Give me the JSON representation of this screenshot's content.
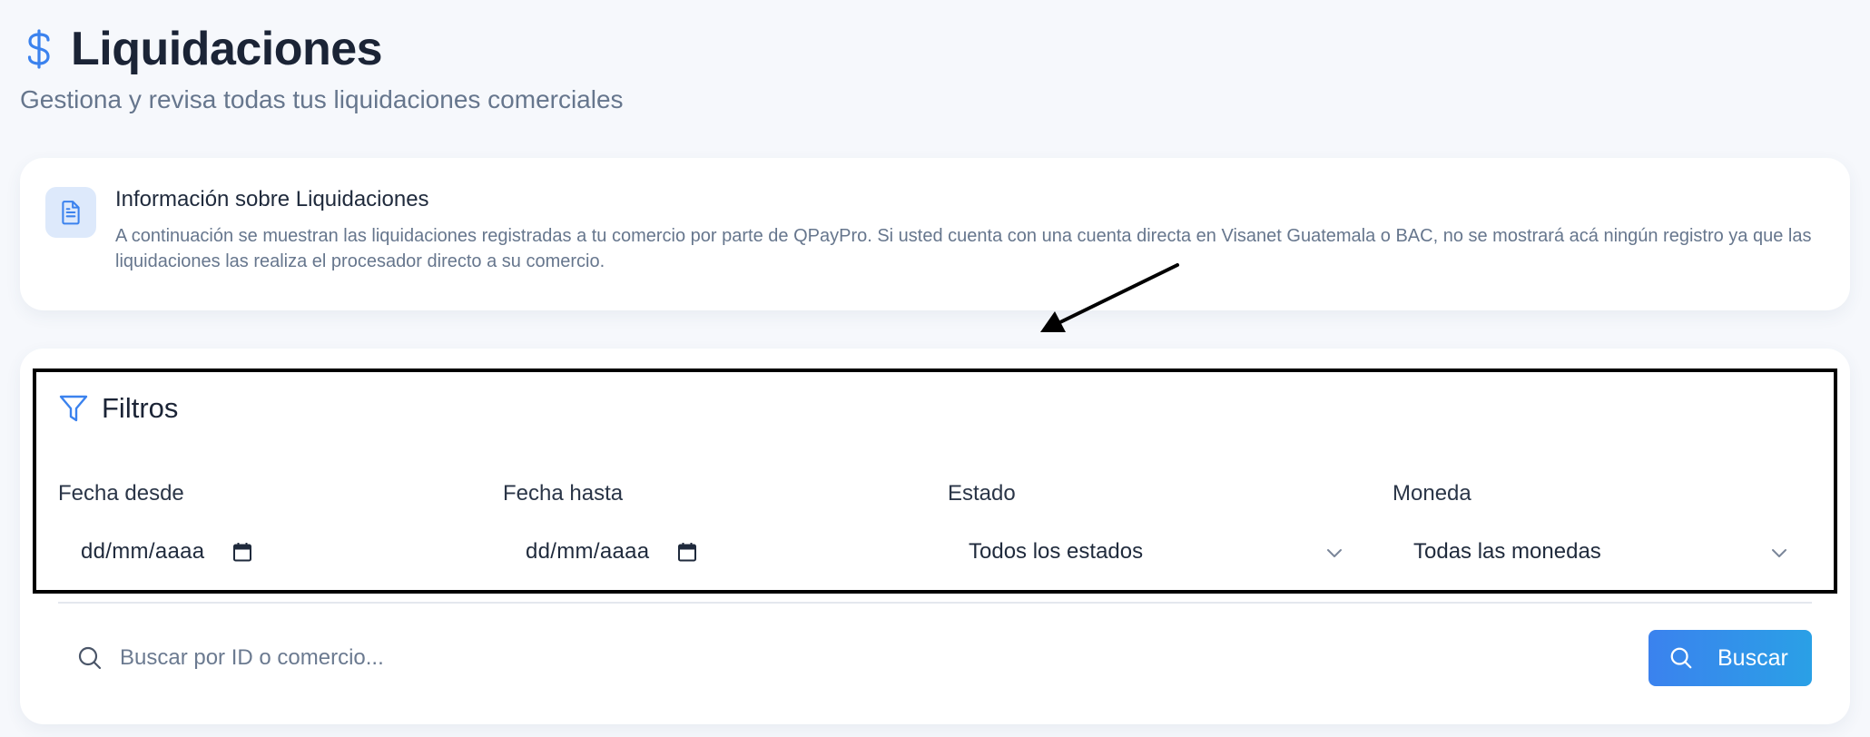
{
  "header": {
    "icon": "dollar-icon",
    "title": "Liquidaciones",
    "subtitle": "Gestiona y revisa todas tus liquidaciones comerciales"
  },
  "info_card": {
    "icon": "document-icon",
    "title": "Información sobre Liquidaciones",
    "text": "A continuación se muestran las liquidaciones registradas a tu comercio por parte de QPayPro. Si usted cuenta con una cuenta directa en Visanet Guatemala o BAC, no se mostrará acá ningún registro ya que las liquidaciones las realiza el procesador directo a su comercio."
  },
  "filters": {
    "icon": "filter-icon",
    "title": "Filtros",
    "fecha_desde": {
      "label": "Fecha desde",
      "value": "dd/mm/aaaa",
      "icon": "calendar-icon"
    },
    "fecha_hasta": {
      "label": "Fecha hasta",
      "value": "dd/mm/aaaa",
      "icon": "calendar-icon"
    },
    "estado": {
      "label": "Estado",
      "selected": "Todos los estados",
      "icon": "chevron-down-icon"
    },
    "moneda": {
      "label": "Moneda",
      "selected": "Todas las monedas",
      "icon": "chevron-down-icon"
    }
  },
  "search": {
    "icon": "search-icon",
    "placeholder": "Buscar por ID o comercio...",
    "button_label": "Buscar"
  },
  "colors": {
    "accent": "#3b82ee",
    "highlight_border": "#000000",
    "muted_text": "#66768d"
  }
}
